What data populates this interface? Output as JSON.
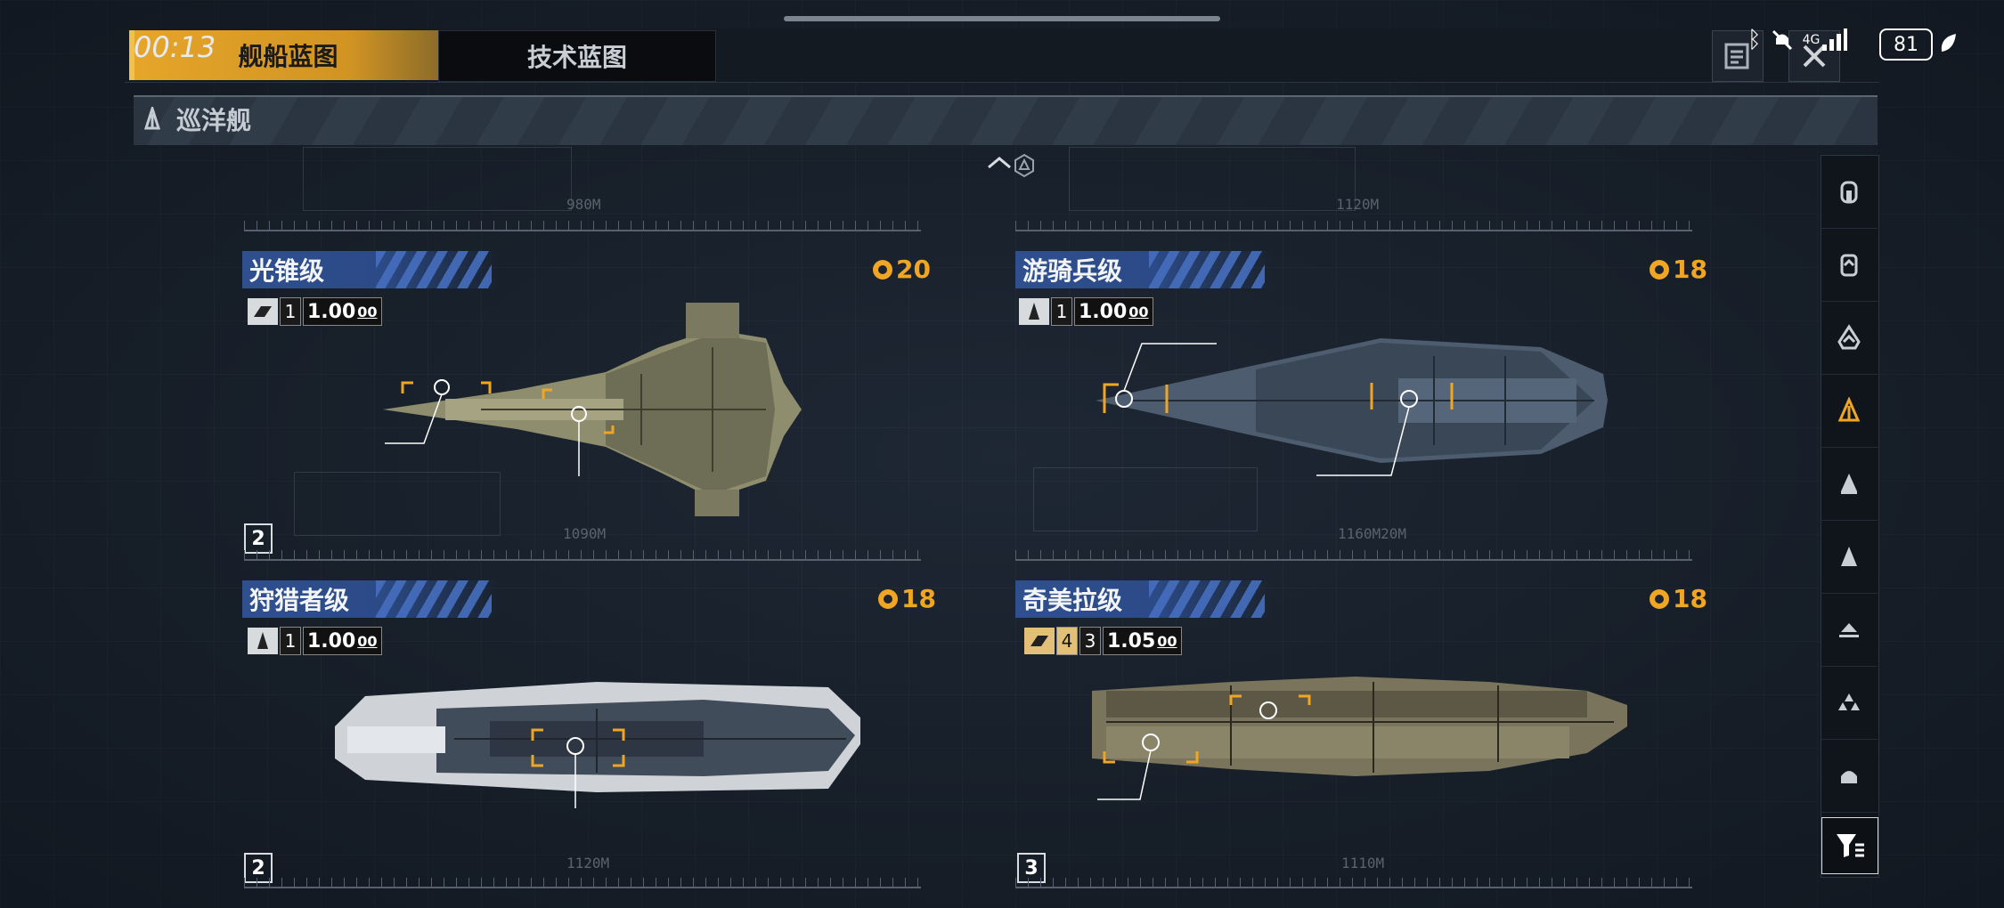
{
  "status_bar": {
    "time": "00:13",
    "network": "4G",
    "battery": "81"
  },
  "tabs": [
    {
      "label": "舰船蓝图",
      "active": true
    },
    {
      "label": "技术蓝图",
      "active": false
    }
  ],
  "category": {
    "label": "巡洋舰",
    "icon": "cruiser-icon"
  },
  "colors": {
    "accent": "#f0a623",
    "title_bg": "#2f4f8f",
    "background": "#1b2430"
  },
  "ships": [
    {
      "name": "光锥级",
      "cost": "20",
      "class_icon": "speed-icon",
      "level": "1",
      "modifier": "1.00",
      "modifier_suffix": "00",
      "tier": "2",
      "scale": "1090M",
      "scale_top": "980M"
    },
    {
      "name": "游骑兵级",
      "cost": "18",
      "class_icon": "cruiser-icon",
      "level": "1",
      "modifier": "1.00",
      "modifier_suffix": "00",
      "tier": "",
      "scale": "1160M20M",
      "scale_top": "1120M"
    },
    {
      "name": "狩猎者级",
      "cost": "18",
      "class_icon": "cruiser-icon",
      "level": "1",
      "modifier": "1.00",
      "modifier_suffix": "00",
      "tier": "2",
      "scale": "1120M",
      "scale_top": ""
    },
    {
      "name": "奇美拉级",
      "cost": "18",
      "class_icon": "speed-icon",
      "level": "4",
      "level2": "3",
      "modifier": "1.05",
      "modifier_suffix": "00",
      "tier": "3",
      "scale": "1110M",
      "scale_top": ""
    }
  ],
  "side_nav": [
    {
      "icon": "carrier-icon",
      "active": false
    },
    {
      "icon": "battlecruiser-icon",
      "active": false
    },
    {
      "icon": "destroyer-heavy-icon",
      "active": false
    },
    {
      "icon": "cruiser-icon",
      "active": true
    },
    {
      "icon": "frigate-icon",
      "active": false
    },
    {
      "icon": "corvette-icon",
      "active": false
    },
    {
      "icon": "support-icon",
      "active": false
    },
    {
      "icon": "fighter-squad-icon",
      "active": false
    },
    {
      "icon": "auxiliary-icon",
      "active": false
    }
  ],
  "filter": {
    "icon": "filter-icon"
  }
}
